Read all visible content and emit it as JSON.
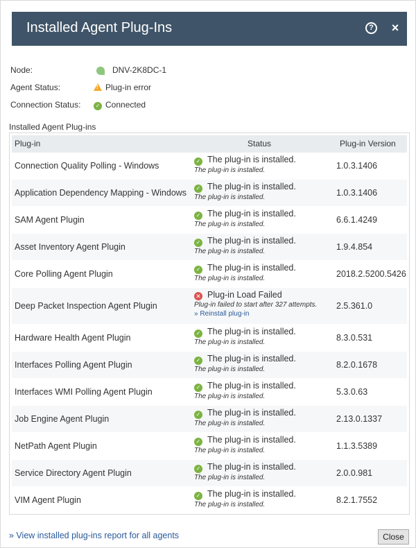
{
  "dialog": {
    "title": "Installed Agent Plug-Ins",
    "help_icon": "?",
    "close_icon": "×"
  },
  "info": {
    "node_label": "Node:",
    "node_value": "DNV-2K8DC-1",
    "agent_status_label": "Agent Status:",
    "agent_status_value": "Plug-in error",
    "connection_status_label": "Connection Status:",
    "connection_status_value": "Connected"
  },
  "section_label": "Installed Agent Plug-ins",
  "table": {
    "headers": {
      "plugin": "Plug-in",
      "status": "Status",
      "version": "Plug-in Version"
    },
    "rows": [
      {
        "name": "Connection Quality Polling - Windows",
        "status": "The plug-in is installed.",
        "detail": "The plug-in is installed.",
        "version": "1.0.3.1406"
      },
      {
        "name": "Application Dependency Mapping - Windows",
        "status": "The plug-in is installed.",
        "detail": "The plug-in is installed.",
        "version": "1.0.3.1406"
      },
      {
        "name": "SAM Agent Plugin",
        "status": "The plug-in is installed.",
        "detail": "The plug-in is installed.",
        "version": "6.6.1.4249"
      },
      {
        "name": "Asset Inventory Agent Plugin",
        "status": "The plug-in is installed.",
        "detail": "The plug-in is installed.",
        "version": "1.9.4.854"
      },
      {
        "name": "Core Polling Agent Plugin",
        "status": "The plug-in is installed.",
        "detail": "The plug-in is installed.",
        "version": "2018.2.5200.5426"
      },
      {
        "name": "Deep Packet Inspection Agent Plugin",
        "status": "Plug-in Load Failed",
        "detail": "Plug-in failed to start after 327 attempts.",
        "action": "» Reinstall plug-in",
        "error": true,
        "version": "2.5.361.0"
      },
      {
        "name": "Hardware Health Agent Plugin",
        "status": "The plug-in is installed.",
        "detail": "The plug-in is installed.",
        "version": "8.3.0.531"
      },
      {
        "name": "Interfaces Polling Agent Plugin",
        "status": "The plug-in is installed.",
        "detail": "The plug-in is installed.",
        "version": "8.2.0.1678"
      },
      {
        "name": "Interfaces WMI Polling Agent Plugin",
        "status": "The plug-in is installed.",
        "detail": "The plug-in is installed.",
        "version": "5.3.0.63"
      },
      {
        "name": "Job Engine Agent Plugin",
        "status": "The plug-in is installed.",
        "detail": "The plug-in is installed.",
        "version": "2.13.0.1337"
      },
      {
        "name": "NetPath Agent Plugin",
        "status": "The plug-in is installed.",
        "detail": "The plug-in is installed.",
        "version": "1.1.3.5389"
      },
      {
        "name": "Service Directory Agent Plugin",
        "status": "The plug-in is installed.",
        "detail": "The plug-in is installed.",
        "version": "2.0.0.981"
      },
      {
        "name": "VIM Agent Plugin",
        "status": "The plug-in is installed.",
        "detail": "The plug-in is installed.",
        "version": "8.2.1.7552"
      }
    ]
  },
  "footer": {
    "report_link": "» View installed plug-ins report for all agents",
    "close_label": "Close"
  },
  "colors": {
    "titlebar": "#3f5468",
    "ok": "#7cb342",
    "error": "#d9534f",
    "warning": "#f0a82c",
    "link": "#2a5a9a"
  }
}
